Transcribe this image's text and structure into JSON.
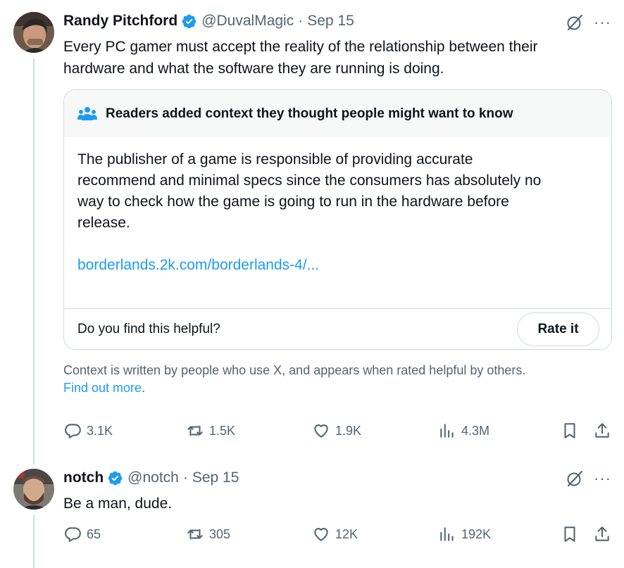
{
  "tweets": [
    {
      "author_name": "Randy Pitchford",
      "handle": "@DuvalMagic",
      "separator": "·",
      "date": "Sep 15",
      "text_lines": [
        "Every PC gamer must accept the reality of the relationship between their",
        "hardware and what the software they are running is doing."
      ],
      "community_note": {
        "header": "Readers added context they thought people might want to know",
        "body_lines": [
          "The publisher of a game is responsible of providing accurate",
          "recommend and minimal specs since the consumers has absolutely no",
          "way to check how the game is going to run in the hardware before",
          "release."
        ],
        "link": "borderlands.2k.com/borderlands-4/...",
        "helpful_question": "Do you find this helpful?",
        "rate_label": "Rate it"
      },
      "context_info": "Context is written by people who use X, and appears when rated helpful by others.",
      "find_out_more": "Find out more",
      "find_out_suffix": ".",
      "stats": {
        "replies": "3.1K",
        "reposts": "1.5K",
        "likes": "1.9K",
        "views": "4.3M"
      }
    },
    {
      "author_name": "notch",
      "handle": "@notch",
      "separator": "·",
      "date": "Sep 15",
      "text": "Be a man, dude.",
      "stats": {
        "replies": "65",
        "reposts": "305",
        "likes": "12K",
        "views": "192K"
      }
    }
  ],
  "icons": {
    "verified": "verified-badge-icon",
    "grok": "grok-icon",
    "more": "more-icon",
    "reply": "reply-icon",
    "repost": "repost-icon",
    "like": "like-icon",
    "views": "views-icon",
    "bookmark": "bookmark-icon",
    "share": "share-icon",
    "community": "community-notes-icon"
  },
  "more_glyph": "···",
  "colors": {
    "accent": "#1d9bf0",
    "text": "#0f1419",
    "muted": "#536471",
    "border": "#cfd9de",
    "note_header_bg": "#f7f9f9"
  }
}
